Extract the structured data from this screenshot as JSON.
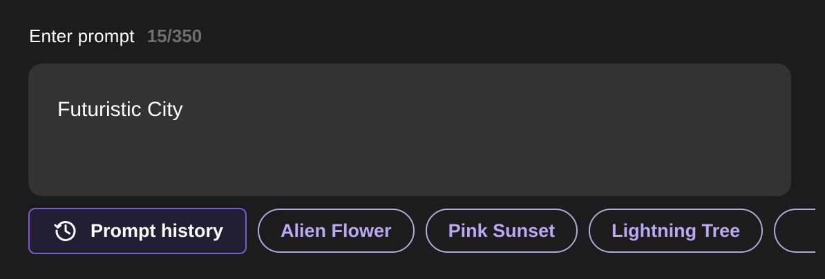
{
  "prompt": {
    "label": "Enter prompt",
    "counter": "15/350",
    "value": "Futuristic City"
  },
  "chips": {
    "history_label": "Prompt history",
    "history_icon": "history-icon",
    "suggestions": [
      "Alien Flower",
      "Pink Sunset",
      "Lightning Tree"
    ]
  },
  "colors": {
    "background": "#1c1c1c",
    "input_bg": "#333333",
    "accent": "#7a5ad8",
    "chip_text": "#b9a8f4"
  }
}
